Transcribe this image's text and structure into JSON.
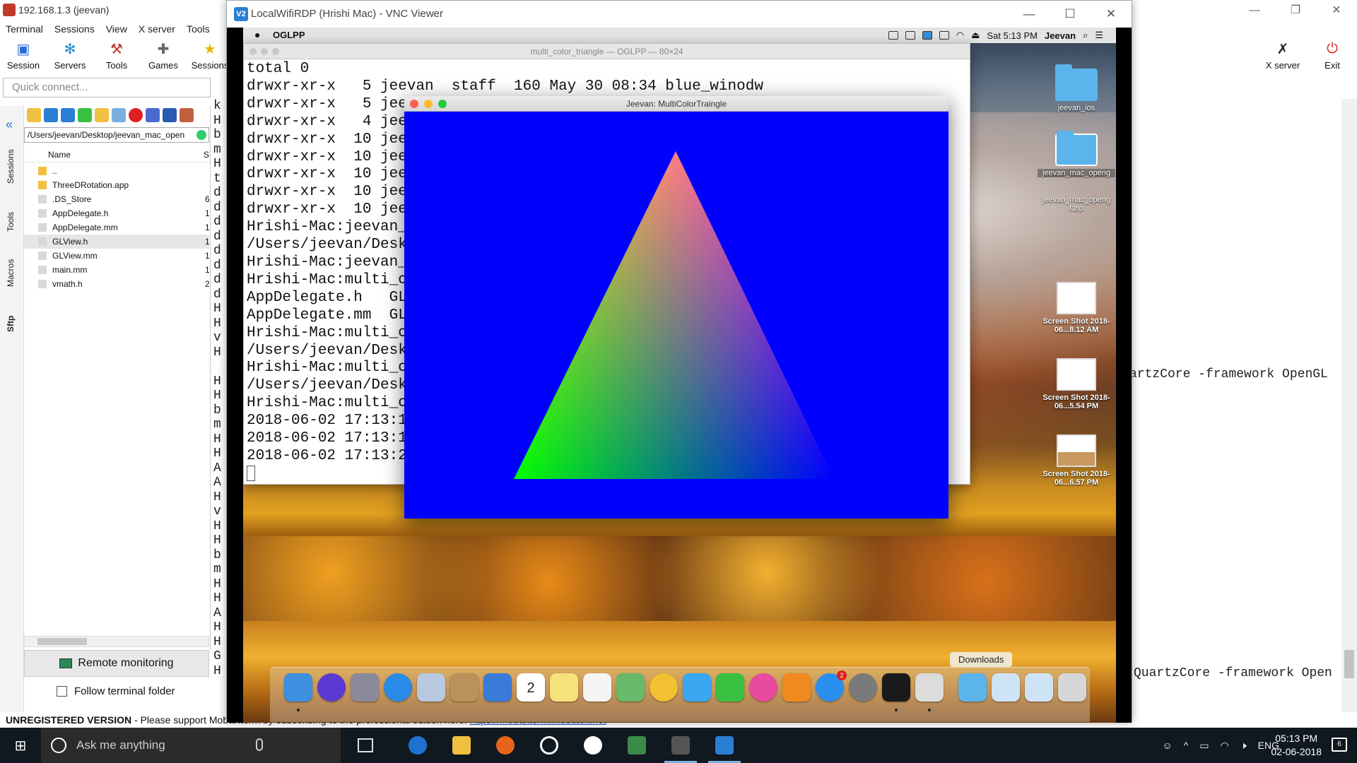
{
  "moba": {
    "title": "192.168.1.3 (jeevan)",
    "menu": [
      "Terminal",
      "Sessions",
      "View",
      "X server",
      "Tools"
    ],
    "toolbar": [
      "Session",
      "Servers",
      "Tools",
      "Games",
      "Sessions"
    ],
    "right_tools": [
      "X server",
      "Exit"
    ],
    "quick_connect_placeholder": "Quick connect...",
    "side_tabs": [
      "Sessions",
      "Tools",
      "Macros",
      "Sftp"
    ],
    "sftp_path": "/Users/jeevan/Desktop/jeevan_mac_open",
    "file_header": {
      "name": "Name",
      "size": "S"
    },
    "files": [
      {
        "name": "..",
        "size": ""
      },
      {
        "name": "ThreeDRotation.app",
        "size": ""
      },
      {
        "name": ".DS_Store",
        "size": "6"
      },
      {
        "name": "AppDelegate.h",
        "size": "1"
      },
      {
        "name": "AppDelegate.mm",
        "size": "1"
      },
      {
        "name": "GLView.h",
        "size": "1"
      },
      {
        "name": "GLView.mm",
        "size": "1"
      },
      {
        "name": "main.mm",
        "size": "1"
      },
      {
        "name": "vmath.h",
        "size": "2"
      }
    ],
    "selected_file": "GLView.h",
    "remote_monitoring": "Remote monitoring",
    "follow_folder": "Follow terminal folder",
    "term_letters": [
      "k",
      "H",
      "b",
      "m",
      "H",
      "t",
      "d",
      "d",
      "d",
      "d",
      "d",
      "d",
      "d",
      "d",
      "H",
      "H",
      "v",
      "H",
      "",
      "H",
      "H",
      "b",
      "m",
      "H",
      "H",
      "A",
      "A",
      "H",
      "v",
      "H",
      "H",
      "b",
      "m",
      "H",
      "H",
      "A",
      "H",
      "H",
      "G",
      "H"
    ],
    "term_frag1": "artzCore -framework OpenGL",
    "term_frag2": "QuartzCore -framework Open",
    "status_bold": "UNREGISTERED VERSION",
    "status_text": " -  Please support MobaXterm by subscribing to the professional edition here: ",
    "status_link": "https://mobaxterm.mobatek.net"
  },
  "vnc": {
    "title": "LocalWifiRDP (Hrishi Mac) - VNC Viewer",
    "icon_label": "V2"
  },
  "mac": {
    "app_name": "OGLPP",
    "clock": "Sat 5:13 PM",
    "user": "Jeevan",
    "terminal": {
      "title": "multi_color_triangle — OGLPP — 80×24",
      "lines": [
        "total 0",
        "drwxr-xr-x   5 jeevan  staff  160 May 30 08:34 blue_winodw",
        "drwxr-xr-x   5 jee",
        "drwxr-xr-x   4 jee",
        "drwxr-xr-x  10 jee",
        "drwxr-xr-x  10 jee",
        "drwxr-xr-x  10 jee",
        "drwxr-xr-x  10 jee",
        "drwxr-xr-x  10 jee",
        "Hrishi-Mac:jeevan_",
        "/Users/jeevan/Desk",
        "Hrishi-Mac:jeevan_",
        "Hrishi-Mac:multi_c",
        "AppDelegate.h   GL",
        "AppDelegate.mm  GL",
        "Hrishi-Mac:multi_c",
        "/Users/jeevan/Desk",
        "Hrishi-Mac:multi_c",
        "/Users/jeevan/Desk",
        "Hrishi-Mac:multi_c",
        "2018-06-02 17:13:1",
        "2018-06-02 17:13:1",
        "2018-06-02 17:13:2"
      ]
    },
    "gl_window": {
      "title": "Jeevan: MultiColorTraingle",
      "background": "#0000ff",
      "vertex_colors": {
        "top": "#ff0000",
        "left": "#00ff00",
        "right": "#0000ff"
      }
    },
    "desktop_icons": [
      {
        "label": "jeevan_ios",
        "kind": "folder"
      },
      {
        "label": "jeevan_mac_openg",
        "kind": "folder"
      },
      {
        "label": "jeevan_mac_openg l.zip",
        "kind": "zip"
      },
      {
        "label": "Screen Shot 2018-06...8.12 AM",
        "kind": "screenshot"
      },
      {
        "label": "Screen Shot 2018-06...5.54 PM",
        "kind": "screenshot"
      },
      {
        "label": "Screen Shot 2018-06...6.57 PM",
        "kind": "screenshot"
      }
    ],
    "dock_tooltip": "Downloads",
    "dock_items": [
      {
        "name": "finder",
        "color": "#3d8fe0"
      },
      {
        "name": "siri",
        "color": "#5a3ad0"
      },
      {
        "name": "launchpad",
        "color": "#8a8a9a"
      },
      {
        "name": "safari",
        "color": "#2a8ae8"
      },
      {
        "name": "mail",
        "color": "#b7c9e0"
      },
      {
        "name": "contacts",
        "color": "#b8925a"
      },
      {
        "name": "xcode",
        "color": "#3a7ad8"
      },
      {
        "name": "calendar",
        "color": "#ffffff"
      },
      {
        "name": "notes",
        "color": "#f6e27a"
      },
      {
        "name": "reminders",
        "color": "#f4f4f4"
      },
      {
        "name": "maps",
        "color": "#6ab86a"
      },
      {
        "name": "photos",
        "color": "#f2c030"
      },
      {
        "name": "messages",
        "color": "#3aa8f0"
      },
      {
        "name": "facetime",
        "color": "#3ac040"
      },
      {
        "name": "itunes",
        "color": "#e84aa0"
      },
      {
        "name": "ibooks",
        "color": "#f08a20"
      },
      {
        "name": "app-store",
        "color": "#2a90f0"
      },
      {
        "name": "system-preferences",
        "color": "#7a7a7a"
      },
      {
        "name": "terminal",
        "color": "#1a1a1a"
      },
      {
        "name": "unknown-app",
        "color": "#dcdcdc"
      },
      {
        "name": "downloads-folder",
        "color": "#5bb4ec"
      },
      {
        "name": "documents-stack",
        "color": "#cfe3f6"
      },
      {
        "name": "screenshots-stack",
        "color": "#cfe3f6"
      },
      {
        "name": "trash",
        "color": "#d6d6d6"
      }
    ],
    "calendar_day": "2",
    "appstore_badge": "2"
  },
  "taskbar": {
    "search_placeholder": "Ask me anything",
    "language": "ENG",
    "time": "05:13 PM",
    "date": "02-06-2018",
    "notif_count": "6"
  }
}
